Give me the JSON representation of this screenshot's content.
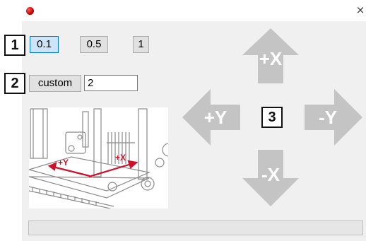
{
  "window": {
    "close_glyph": "×"
  },
  "labels": {
    "step_size_marker": "1",
    "custom_marker": "2",
    "direction_marker": "3"
  },
  "step_buttons": [
    {
      "label": "0.1",
      "selected": true
    },
    {
      "label": "0.5",
      "selected": false
    },
    {
      "label": "1",
      "selected": false
    }
  ],
  "custom": {
    "button_label": "custom",
    "input_value": "2"
  },
  "illustration": {
    "axis_y_label": "+Y",
    "axis_x_label": "+X",
    "axis_color": "#d0102a"
  },
  "jog": {
    "plus_x": "+X",
    "minus_x": "-X",
    "plus_y": "+Y",
    "minus_y": "-Y",
    "arrow_color": "#c4c4c4"
  },
  "status": {
    "progress": 0
  }
}
